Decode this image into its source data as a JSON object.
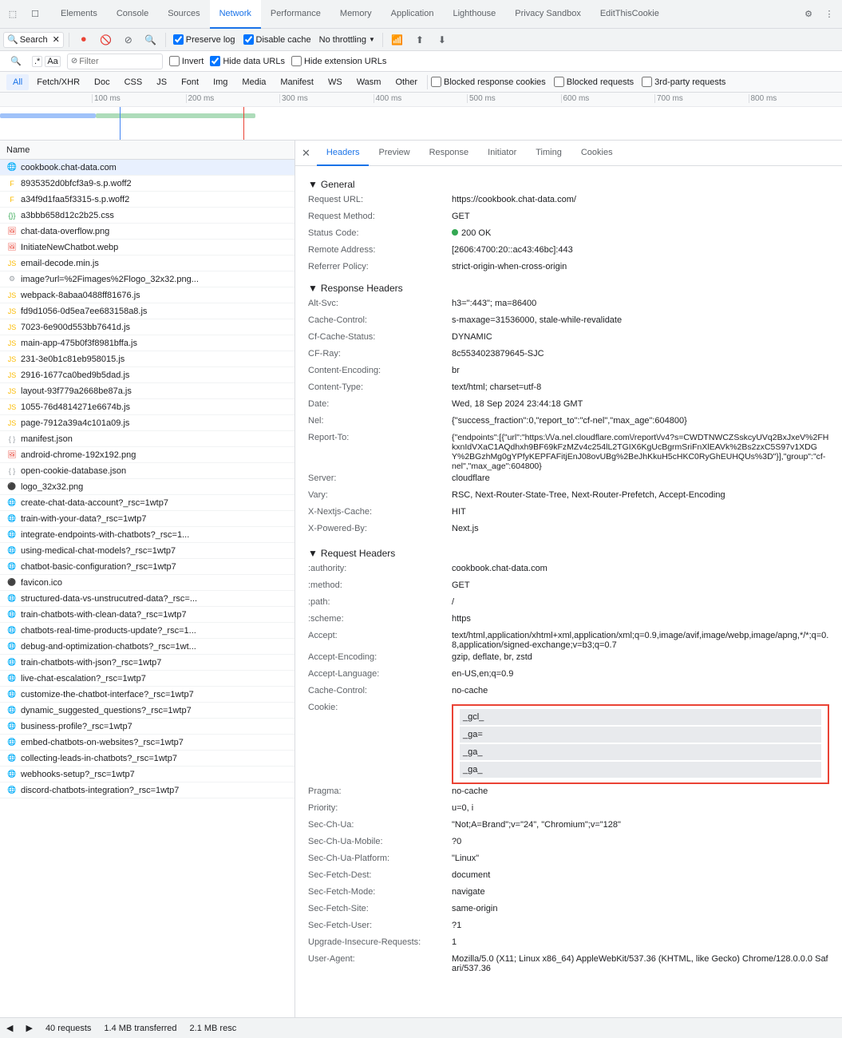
{
  "tabs": {
    "items": [
      {
        "label": "Elements",
        "active": false
      },
      {
        "label": "Console",
        "active": false
      },
      {
        "label": "Sources",
        "active": false
      },
      {
        "label": "Network",
        "active": true
      },
      {
        "label": "Performance",
        "active": false
      },
      {
        "label": "Memory",
        "active": false
      },
      {
        "label": "Application",
        "active": false
      },
      {
        "label": "Lighthouse",
        "active": false
      },
      {
        "label": "Privacy Sandbox",
        "active": false
      },
      {
        "label": "EditThisCookie",
        "active": false
      }
    ]
  },
  "toolbar": {
    "search_label": "Search",
    "preserve_log": "Preserve log",
    "disable_cache": "Disable cache",
    "no_throttling": "No throttling",
    "filter_placeholder": "Filter"
  },
  "filter_row": {
    "invert": "Invert",
    "hide_data_urls": "Hide data URLs",
    "hide_ext_urls": "Hide extension URLs"
  },
  "type_filters": [
    "All",
    "Fetch/XHR",
    "Doc",
    "CSS",
    "JS",
    "Font",
    "Img",
    "Media",
    "Manifest",
    "WS",
    "Wasm",
    "Other"
  ],
  "blocked_filters": [
    "Blocked response cookies",
    "Blocked requests"
  ],
  "third_party": "3rd-party requests",
  "ruler_ticks": [
    "100 ms",
    "200 ms",
    "300 ms",
    "400 ms",
    "500 ms",
    "600 ms",
    "700 ms",
    "800 ms"
  ],
  "requests_header": "Name",
  "requests": [
    {
      "name": "cookbook.chat-data.com",
      "type": "doc",
      "selected": true
    },
    {
      "name": "8935352d0bfcf3a9-s.p.woff2",
      "type": "font"
    },
    {
      "name": "a34f9d1faa5f3315-s.p.woff2",
      "type": "font"
    },
    {
      "name": "a3bbb658d12c2b25.css",
      "type": "css"
    },
    {
      "name": "chat-data-overflow.png",
      "type": "img"
    },
    {
      "name": "InitiateNewChatbot.webp",
      "type": "img"
    },
    {
      "name": "email-decode.min.js",
      "type": "js"
    },
    {
      "name": "image?url=%2Fimages%2Flogo_32x32.png...",
      "type": "img"
    },
    {
      "name": "webpack-8abaa0488ff81676.js",
      "type": "js"
    },
    {
      "name": "fd9d1056-0d5ea7ee683158a8.js",
      "type": "js"
    },
    {
      "name": "7023-6e900d553bb7641d.js",
      "type": "js"
    },
    {
      "name": "main-app-475b0f3f8981bffa.js",
      "type": "js"
    },
    {
      "name": "231-3e0b1c81eb958015.js",
      "type": "js"
    },
    {
      "name": "2916-1677ca0bed9b5dad.js",
      "type": "js"
    },
    {
      "name": "layout-93f779a2668be87a.js",
      "type": "js"
    },
    {
      "name": "1055-76d4814271e6674b.js",
      "type": "js"
    },
    {
      "name": "page-7912a39a4c101a09.js",
      "type": "js"
    },
    {
      "name": "manifest.json",
      "type": "json"
    },
    {
      "name": "android-chrome-192x192.png",
      "type": "img"
    },
    {
      "name": "open-cookie-database.json",
      "type": "json"
    },
    {
      "name": "logo_32x32.png",
      "type": "img"
    },
    {
      "name": "create-chat-data-account?_rsc=1wtp7",
      "type": "doc"
    },
    {
      "name": "train-with-your-data?_rsc=1wtp7",
      "type": "doc"
    },
    {
      "name": "integrate-endpoints-with-chatbots?_rsc=1...",
      "type": "doc"
    },
    {
      "name": "using-medical-chat-models?_rsc=1wtp7",
      "type": "doc"
    },
    {
      "name": "chatbot-basic-configuration?_rsc=1wtp7",
      "type": "doc"
    },
    {
      "name": "favicon.ico",
      "type": "img"
    },
    {
      "name": "structured-data-vs-unstrucutred-data?_rsc=...",
      "type": "doc"
    },
    {
      "name": "train-chatbots-with-clean-data?_rsc=1wtp7",
      "type": "doc"
    },
    {
      "name": "chatbots-real-time-products-update?_rsc=1...",
      "type": "doc"
    },
    {
      "name": "debug-and-optimization-chatbots?_rsc=1wt...",
      "type": "doc"
    },
    {
      "name": "train-chatbots-with-json?_rsc=1wtp7",
      "type": "doc"
    },
    {
      "name": "live-chat-escalation?_rsc=1wtp7",
      "type": "doc"
    },
    {
      "name": "customize-the-chatbot-interface?_rsc=1wtp7",
      "type": "doc"
    },
    {
      "name": "dynamic_suggested_questions?_rsc=1wtp7",
      "type": "doc"
    },
    {
      "name": "business-profile?_rsc=1wtp7",
      "type": "doc"
    },
    {
      "name": "embed-chatbots-on-websites?_rsc=1wtp7",
      "type": "doc"
    },
    {
      "name": "collecting-leads-in-chatbots?_rsc=1wtp7",
      "type": "doc"
    },
    {
      "name": "webhooks-setup?_rsc=1wtp7",
      "type": "doc"
    },
    {
      "name": "discord-chatbots-integration?_rsc=1wtp7",
      "type": "doc"
    }
  ],
  "panel_tabs": [
    "×",
    "Headers",
    "Preview",
    "Response",
    "Initiator",
    "Timing",
    "Cookies"
  ],
  "general": {
    "title": "▼ General",
    "request_url_key": "Request URL:",
    "request_url_val": "https://cookbook.chat-data.com/",
    "request_method_key": "Request Method:",
    "request_method_val": "GET",
    "status_code_key": "Status Code:",
    "status_code_val": "200 OK",
    "remote_address_key": "Remote Address:",
    "remote_address_val": "[2606:4700:20::ac43:46bc]:443",
    "referrer_policy_key": "Referrer Policy:",
    "referrer_policy_val": "strict-origin-when-cross-origin"
  },
  "response_headers": {
    "title": "▼ Response Headers",
    "headers": [
      {
        "key": "Alt-Svc:",
        "val": "h3=\":443\"; ma=86400"
      },
      {
        "key": "Cache-Control:",
        "val": "s-maxage=31536000, stale-while-revalidate"
      },
      {
        "key": "Cf-Cache-Status:",
        "val": "DYNAMIC"
      },
      {
        "key": "CF-Ray:",
        "val": "8c5534023879645-SJC"
      },
      {
        "key": "Content-Encoding:",
        "val": "br"
      },
      {
        "key": "Content-Type:",
        "val": "text/html; charset=utf-8"
      },
      {
        "key": "Date:",
        "val": "Wed, 18 Sep 2024 23:44:18 GMT"
      },
      {
        "key": "Nel:",
        "val": "{\"success_fraction\":0,\"report_to\":\"cf-nel\",\"max_age\":604800}"
      },
      {
        "key": "Report-To:",
        "val": "{\"endpoints\":[{\"url\":\"https:\\/\\/a.nel.cloudflare.com\\/report\\/v4?s=CWDTNWCZSskcyUVq2BxJxeV%2FHkxnIdVXaC1AQdhxh9BF69kFzMZv4c254lL2TGIX6KgUcBgrmSriFnXlEAVk%2Bs2zxC5S97v1XDGY%2BGzhMg0gYPfyKEPFAFitjEnJ08ovUBg%2BeJhKkuH5cHKC0RyGhEUHQUs%3D\"}],\"group\":\"cf-nel\",\"max_age\":604800}"
      },
      {
        "key": "Server:",
        "val": "cloudflare"
      },
      {
        "key": "Vary:",
        "val": "RSC, Next-Router-State-Tree, Next-Router-Prefetch, Accept-Encoding"
      },
      {
        "key": "X-Nextjs-Cache:",
        "val": "HIT"
      },
      {
        "key": "X-Powered-By:",
        "val": "Next.js"
      }
    ]
  },
  "request_headers": {
    "title": "▼ Request Headers",
    "headers": [
      {
        "key": ":authority:",
        "val": "cookbook.chat-data.com"
      },
      {
        "key": ":method:",
        "val": "GET"
      },
      {
        "key": ":path:",
        "val": "/"
      },
      {
        "key": ":scheme:",
        "val": "https"
      },
      {
        "key": "Accept:",
        "val": "text/html,application/xhtml+xml,application/xml;q=0.9,image/avif,image/webp,image/apng,*/*;q=0.8,application/signed-exchange;v=b3;q=0.7"
      },
      {
        "key": "Accept-Encoding:",
        "val": "gzip, deflate, br, zstd"
      },
      {
        "key": "Accept-Language:",
        "val": "en-US,en;q=0.9"
      },
      {
        "key": "Cache-Control:",
        "val": "no-cache"
      },
      {
        "key": "Cookie:",
        "val": "cookie_values",
        "is_cookie": true
      },
      {
        "key": "Pragma:",
        "val": "no-cache"
      },
      {
        "key": "Priority:",
        "val": "u=0, i"
      },
      {
        "key": "Sec-Ch-Ua:",
        "val": "\"Not;A=Brand\";v=\"24\", \"Chromium\";v=\"128\""
      },
      {
        "key": "Sec-Ch-Ua-Mobile:",
        "val": "?0"
      },
      {
        "key": "Sec-Ch-Ua-Platform:",
        "val": "\"Linux\""
      },
      {
        "key": "Sec-Fetch-Dest:",
        "val": "document"
      },
      {
        "key": "Sec-Fetch-Mode:",
        "val": "navigate"
      },
      {
        "key": "Sec-Fetch-Site:",
        "val": "same-origin"
      },
      {
        "key": "Sec-Fetch-User:",
        "val": "?1"
      },
      {
        "key": "Upgrade-Insecure-Requests:",
        "val": "1"
      },
      {
        "key": "User-Agent:",
        "val": "Mozilla/5.0 (X11; Linux x86_64) AppleWebKit/537.36 (KHTML, like Gecko) Chrome/128.0.0.0 Safari/537.36"
      }
    ]
  },
  "cookies": [
    "_gcl_",
    "_ga=",
    "_ga_",
    "_ga_"
  ],
  "status_bar": {
    "requests": "40 requests",
    "transferred": "1.4 MB transferred",
    "resources": "2.1 MB resc"
  }
}
